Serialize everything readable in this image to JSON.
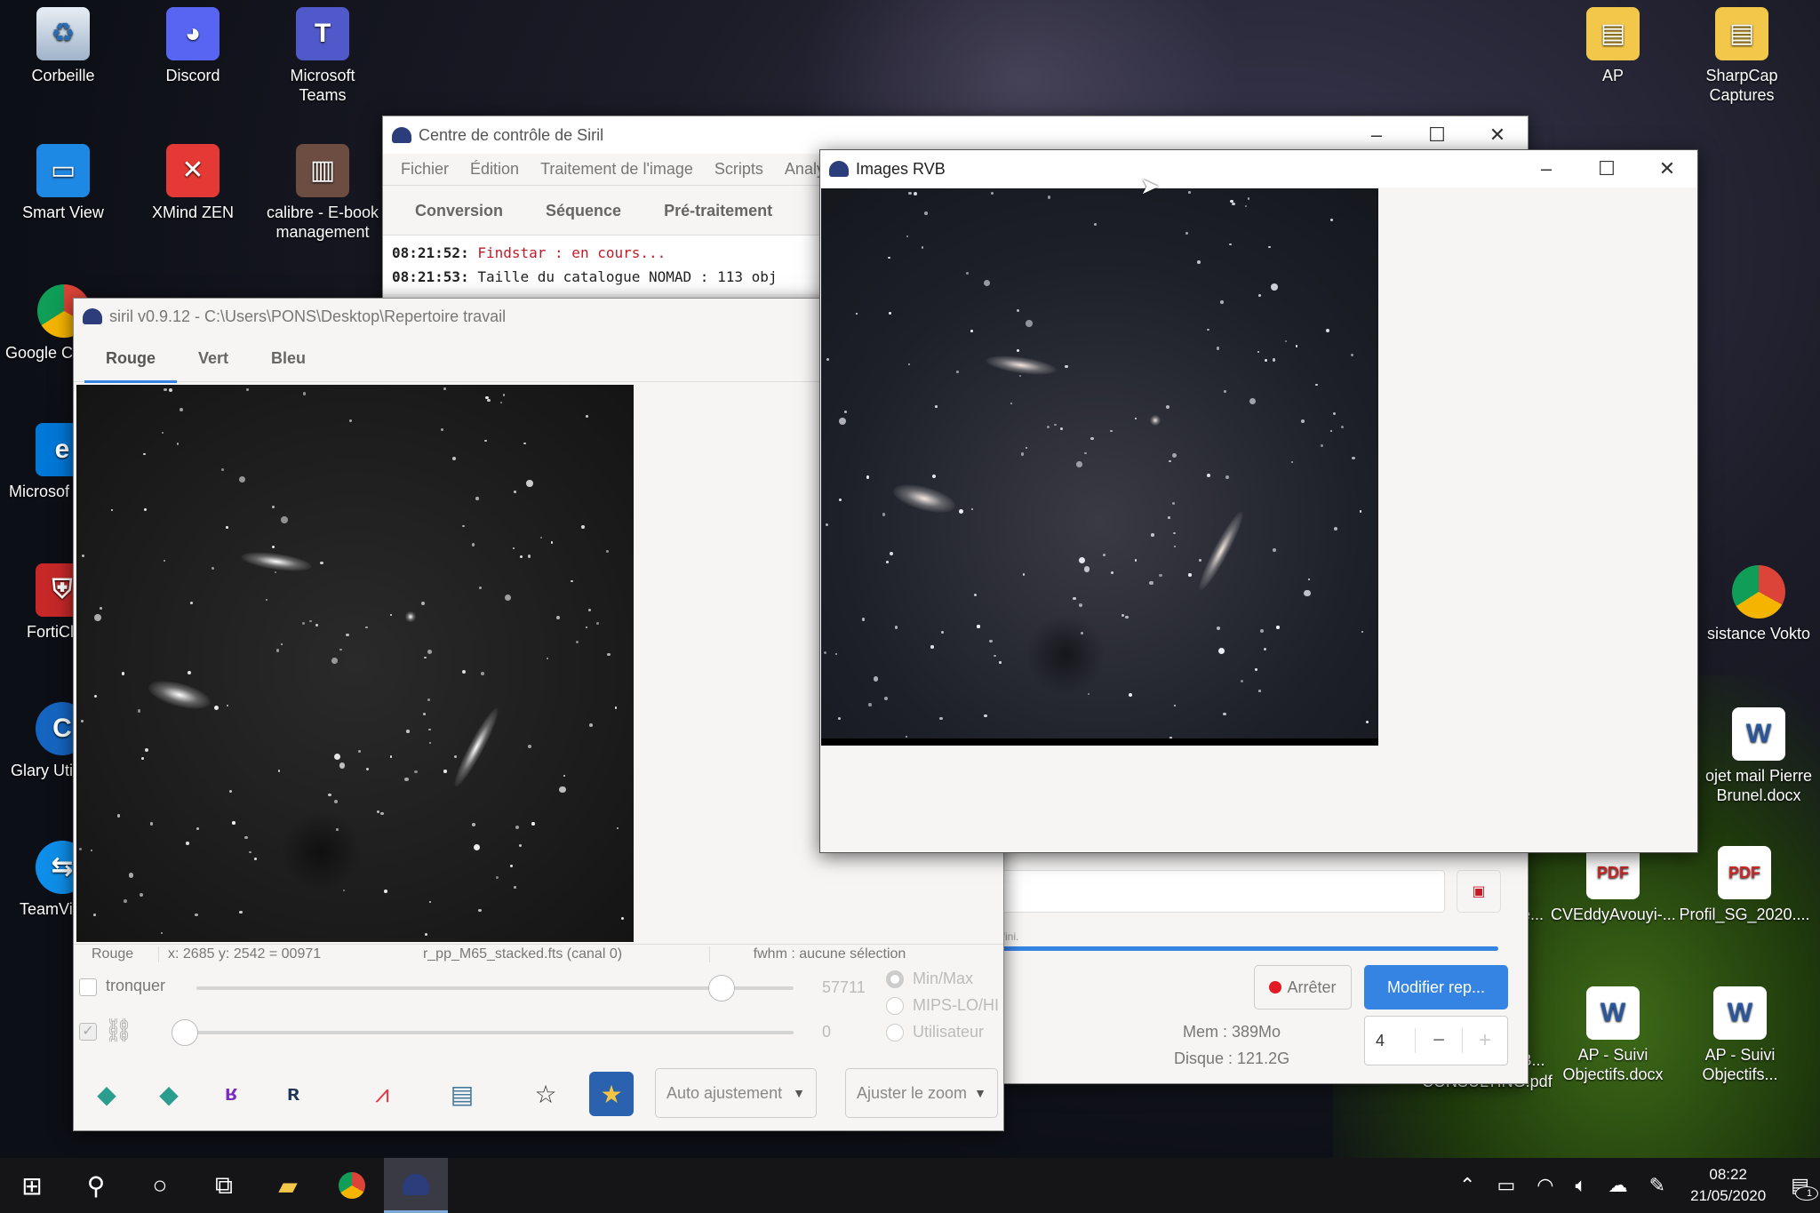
{
  "desktop": {
    "icons_left": [
      {
        "name": "recycle-bin",
        "label": "Corbeille"
      },
      {
        "name": "discord",
        "label": "Discord"
      },
      {
        "name": "teams",
        "label": "Microsoft Teams"
      },
      {
        "name": "smart-view",
        "label": "Smart View"
      },
      {
        "name": "xmind",
        "label": "XMind ZEN"
      },
      {
        "name": "calibre",
        "label": "calibre - E-book management"
      },
      {
        "name": "google-chrome",
        "label": "Google C"
      },
      {
        "name": "microsoft-edge",
        "label": "Microsof"
      },
      {
        "name": "forticlient",
        "label": "FortiCl"
      },
      {
        "name": "glary",
        "label": "Glary Uti"
      },
      {
        "name": "teamviewer",
        "label": "TeamVi"
      }
    ],
    "icons_right": [
      {
        "name": "ap",
        "label": "AP"
      },
      {
        "name": "sharpcap",
        "label": "SharpCap Captures"
      },
      {
        "name": "assistance",
        "label": "sistance Vokto"
      },
      {
        "name": "objet-mail",
        "label": "ojet mail Pierre Brunel.docx"
      },
      {
        "name": "cv",
        "label": "CVEddyAvouyi-..."
      },
      {
        "name": "profil",
        "label": "Profil_SG_2020...."
      },
      {
        "name": "ap-suivi-1",
        "label": "AP - Suivi Objectifs.docx"
      },
      {
        "name": "ap-suivi-2",
        "label": "AP - Suivi Objectifs..."
      },
      {
        "name": "partial-pdf",
        "label": "CONSULTING.pdf"
      },
      {
        "name": "partial-e",
        "label": "e..."
      },
      {
        "name": "partial-b",
        "label": "B..."
      }
    ]
  },
  "control_window": {
    "title": "Centre de contrôle de Siril",
    "menu": [
      "Fichier",
      "Édition",
      "Traitement de l'image",
      "Scripts",
      "Analys"
    ],
    "tabs": [
      "Conversion",
      "Séquence",
      "Pré-traitement"
    ],
    "log": [
      {
        "time": "08:21:52:",
        "text": "Findstar : en cours..."
      },
      {
        "time": "08:21:53:",
        "text": "Taille du catalogue NOMAD : 113 obj"
      }
    ],
    "progress_text": "t fini.",
    "stop_label": "Arrêter",
    "modify_label": "Modifier rep...",
    "mem_label": "Mem : 389Mo",
    "disk_label": "Disque : 121.2G",
    "threads_value": "4",
    "minus": "−",
    "plus": "+"
  },
  "image_window": {
    "title": "siril v0.9.12 - C:\\Users\\PONS\\Desktop\\Repertoire travail",
    "tabs": [
      "Rouge",
      "Vert",
      "Bleu"
    ],
    "status_channel": "Rouge",
    "status_coords": "x: 2685 y: 2542 = 00971",
    "status_file": "r_pp_M65_stacked.fts (canal 0)",
    "status_fwhm": "fwhm : aucune sélection",
    "tronquer_label": "tronquer",
    "high_value": "57711",
    "low_value": "0",
    "radio_minmax": "Min/Max",
    "radio_mips": "MIPS-LO/HI",
    "radio_user": "Utilisateur",
    "auto_adjust": "Auto ajustement",
    "zoom_adjust": "Ajuster le zoom",
    "high_slider_fraction": 0.88,
    "low_slider_fraction": 0.0
  },
  "rgb_window": {
    "title": "Images RVB"
  },
  "taskbar": {
    "time": "08:22",
    "date": "21/05/2020",
    "notification_count": "1"
  }
}
